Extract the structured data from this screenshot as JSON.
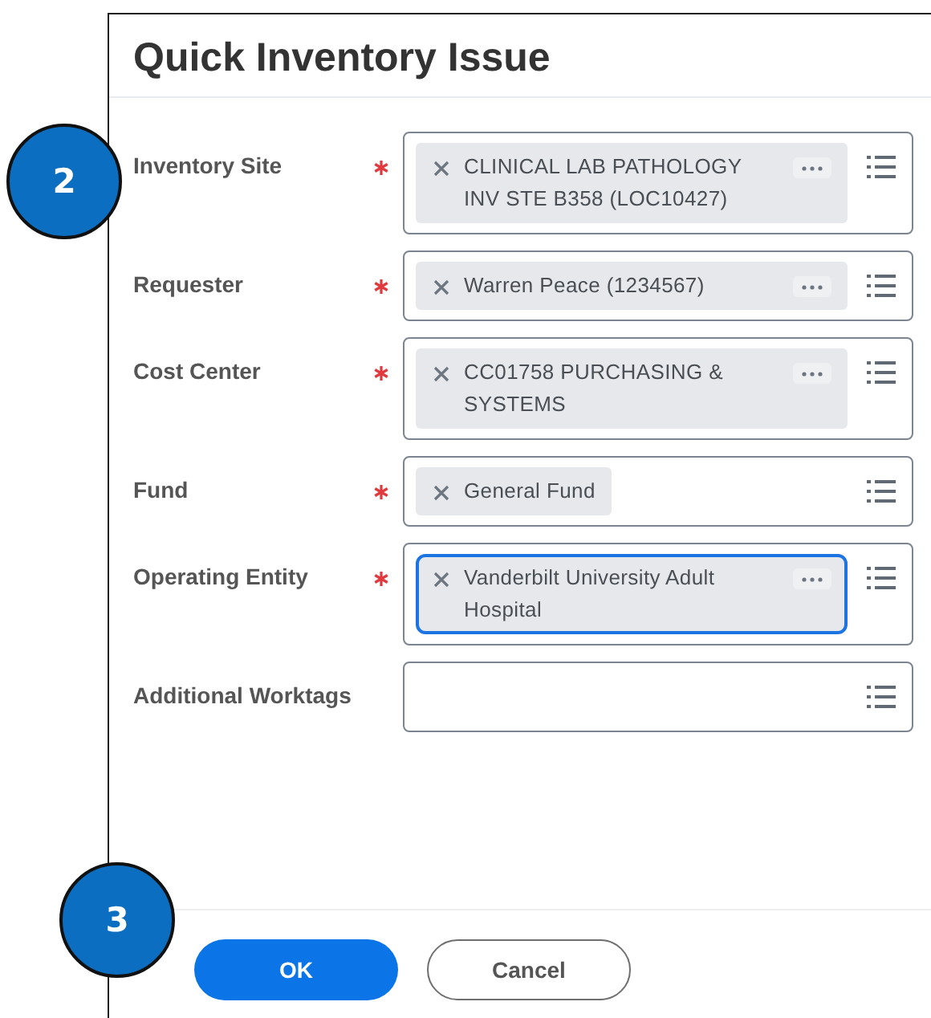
{
  "dialog": {
    "title": "Quick Inventory Issue"
  },
  "fields": [
    {
      "label": "Inventory Site",
      "required": true,
      "chip": {
        "text": "CLINICAL LAB PATHOLOGY INV STE B358 (LOC10427)",
        "menu": true,
        "focused": false
      }
    },
    {
      "label": "Requester",
      "required": true,
      "chip": {
        "text": "Warren Peace (1234567)",
        "menu": true,
        "focused": false
      }
    },
    {
      "label": "Cost Center",
      "required": true,
      "chip": {
        "text": "CC01758 PURCHASING & SYSTEMS",
        "menu": true,
        "focused": false
      }
    },
    {
      "label": "Fund",
      "required": true,
      "chip": {
        "text": "General Fund",
        "menu": false,
        "focused": false
      }
    },
    {
      "label": "Operating Entity",
      "required": true,
      "chip": {
        "text": "Vanderbilt University Adult Hospital",
        "menu": true,
        "focused": true
      }
    },
    {
      "label": "Additional Worktags",
      "required": false
    }
  ],
  "buttons": [
    {
      "label": "OK",
      "kind": "primary"
    },
    {
      "label": "Cancel",
      "kind": "secondary"
    }
  ],
  "callouts": [
    "2",
    "3"
  ]
}
